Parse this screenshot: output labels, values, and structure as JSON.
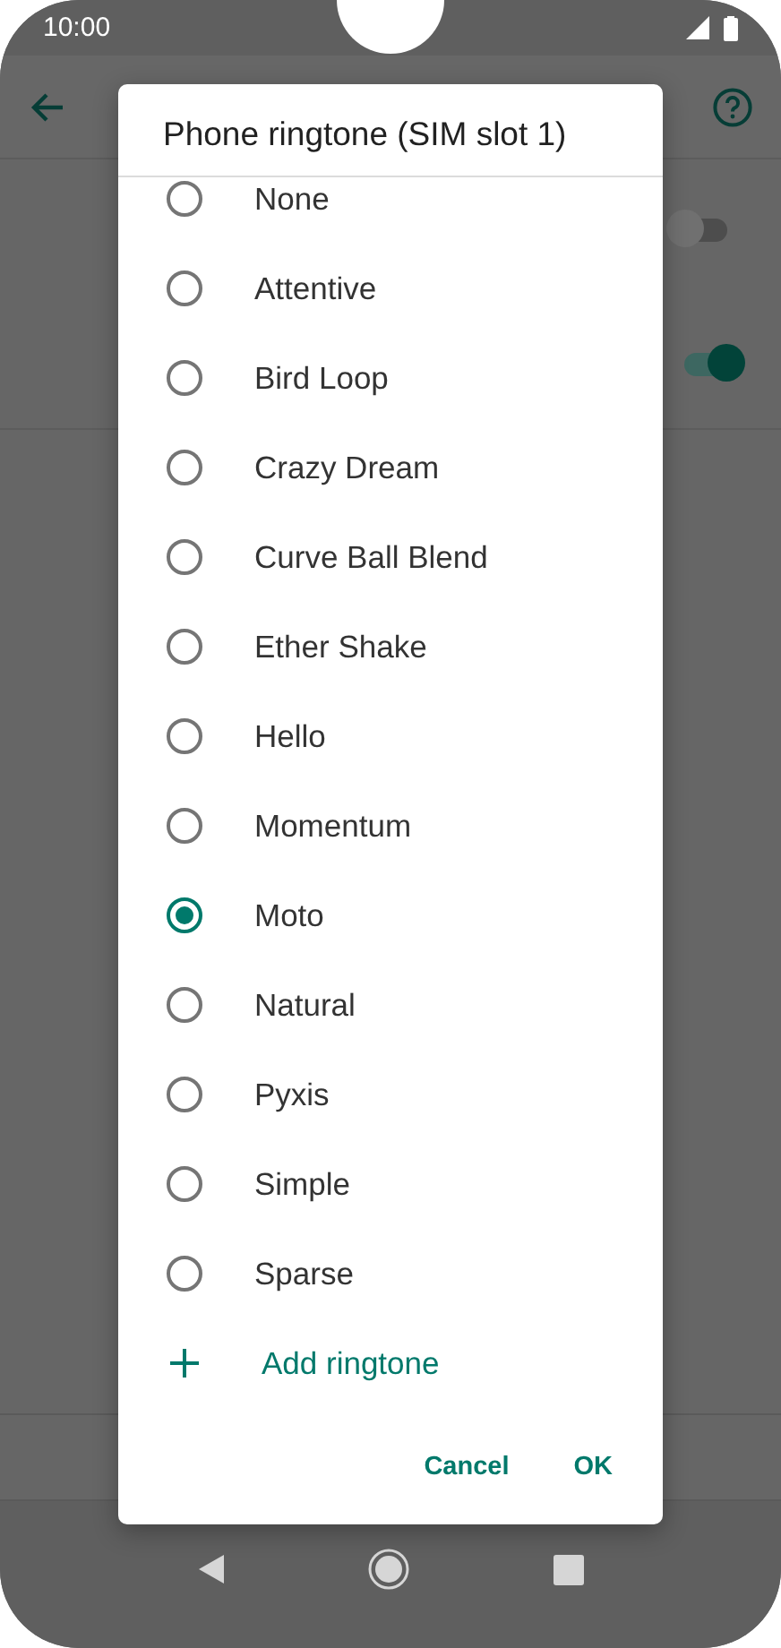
{
  "status_bar": {
    "time": "10:00"
  },
  "settings": [
    {
      "kind": "toggle",
      "on": false
    },
    {
      "kind": "toggle",
      "on": true
    }
  ],
  "dialog": {
    "title": "Phone ringtone (SIM slot 1)",
    "options": [
      {
        "label": "None",
        "selected": false
      },
      {
        "label": "Attentive",
        "selected": false
      },
      {
        "label": "Bird Loop",
        "selected": false
      },
      {
        "label": "Crazy Dream",
        "selected": false
      },
      {
        "label": "Curve Ball Blend",
        "selected": false
      },
      {
        "label": "Ether Shake",
        "selected": false
      },
      {
        "label": "Hello",
        "selected": false
      },
      {
        "label": "Momentum",
        "selected": false
      },
      {
        "label": "Moto",
        "selected": true
      },
      {
        "label": "Natural",
        "selected": false
      },
      {
        "label": "Pyxis",
        "selected": false
      },
      {
        "label": "Simple",
        "selected": false
      },
      {
        "label": "Sparse",
        "selected": false
      }
    ],
    "add_action": {
      "label": "Add ringtone"
    },
    "buttons": [
      "Cancel",
      "OK"
    ]
  }
}
